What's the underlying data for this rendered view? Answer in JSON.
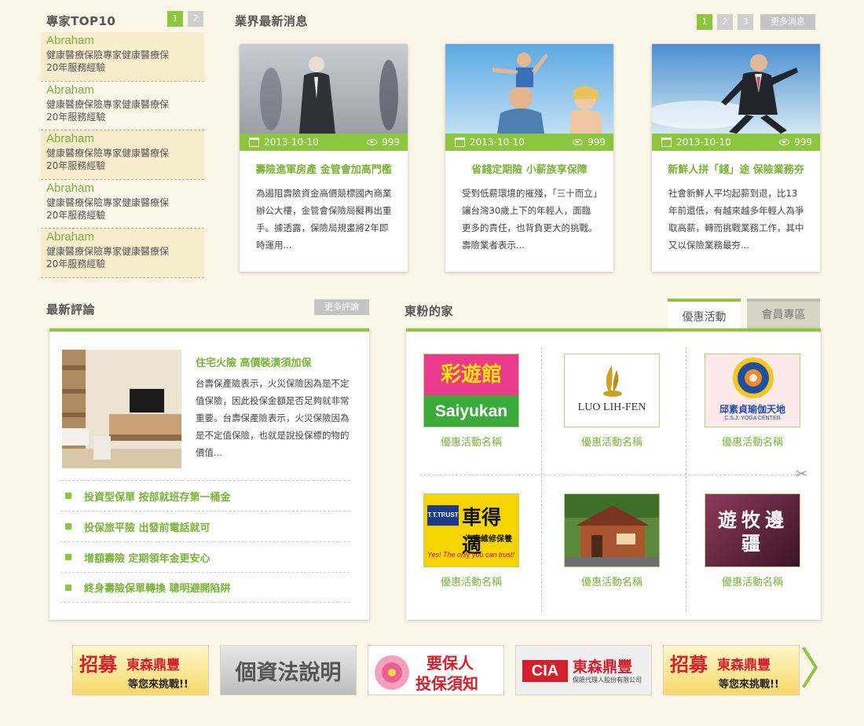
{
  "experts": {
    "title": "專家TOP10",
    "pages": [
      "1",
      "2"
    ],
    "items": [
      {
        "name": "Abraham",
        "desc1": "健康醫療保險專家健康醫療保",
        "desc2": "20年服務經驗"
      },
      {
        "name": "Abraham",
        "desc1": "健康醫療保險專家健康醫療保",
        "desc2": "20年服務經驗"
      },
      {
        "name": "Abraham",
        "desc1": "健康醫療保險專家健康醫療保",
        "desc2": "20年服務經驗"
      },
      {
        "name": "Abraham",
        "desc1": "健康醫療保險專家健康醫療保",
        "desc2": "20年服務經驗"
      },
      {
        "name": "Abraham",
        "desc1": "健康醫療保險專家健康醫療保",
        "desc2": "20年服務經驗"
      }
    ]
  },
  "news": {
    "title": "業界最新消息",
    "pages": [
      "1",
      "2",
      "3"
    ],
    "more": "更多消息",
    "cards": [
      {
        "date": "2013-10-10",
        "views": "999",
        "title": "壽險進軍房產 金管會加高門檻",
        "text": "為遏阻壽險資金高價競標國內商業辦公大樓，金管會保險局擬再出重手。據透露，保險局規畫將2年即時運用..."
      },
      {
        "date": "2013-10-10",
        "views": "999",
        "title": "省錢定期險 小薪族享保障",
        "text": "受到低薪環境的摧殘，「三十而立」讓台灣30歲上下的年輕人，面臨更多的責任，也背負更大的挑戰。壽險業者表示..."
      },
      {
        "date": "2013-10-10",
        "views": "999",
        "title": "新鮮人拼「錢」途 保險業務夯",
        "text": "社會新鮮人平均起薪到退，比13年前還低，有越來越多年輕人為爭取高薪，轉而挑戰業務工作，其中又以保險業務最夯..."
      }
    ]
  },
  "reviews": {
    "title": "最新評論",
    "more": "更多評論",
    "featured_title": "住宅火險 高價裝潢須加保",
    "featured_text": "台壽保產險表示，火災保險因為是不定值保險，因此投保金額是否足夠就非常重要。台壽保產險表示，火災保險因為是不定值保險，也就是說投保標的物的價值...",
    "items": [
      "投資型保單 按部就班存第一桶金",
      "投保旅平險 出發前電話就可",
      "增額壽險 定期領年金更安心",
      "終身壽險保單轉換 聰明避開陷阱"
    ]
  },
  "fans": {
    "title": "東粉的家",
    "tabs": [
      "優惠活動",
      "會員專區"
    ],
    "logos": [
      {
        "label": "優惠活動名稱",
        "line1": "彩遊館",
        "line2": "Saiyukan"
      },
      {
        "label": "優惠活動名稱",
        "line1": "LUO LIH-FEN"
      },
      {
        "label": "優惠活動名稱",
        "line1": "邱素貞瑜伽天地",
        "line2": "C.S.J. YOGA CENTER"
      },
      {
        "label": "優惠活動名稱",
        "line1": "車得適",
        "line2": "汽車維修保養",
        "line3": "Yes! The only you can trust!",
        "badge": "T.T.TRUST"
      },
      {
        "label": "優惠活動名稱"
      },
      {
        "label": "優惠活動名稱",
        "line1": "遊牧邊疆"
      }
    ]
  },
  "banners": [
    {
      "line1": "招募",
      "line2": "東森鼎豐",
      "line3": "等您來挑戰!!"
    },
    {
      "line1": "個資法說明"
    },
    {
      "line1": "要保人",
      "line2": "投保須知"
    },
    {
      "line1": "東森鼎豐",
      "line2": "保險代理人股份有限公司"
    },
    {
      "line1": "招募",
      "line2": "東森鼎豐",
      "line3": "等您來挑戰!!"
    }
  ],
  "colors": {
    "accent": "#8cc63f",
    "accent_text": "#7ab23a",
    "bg": "#fcf6e8"
  }
}
